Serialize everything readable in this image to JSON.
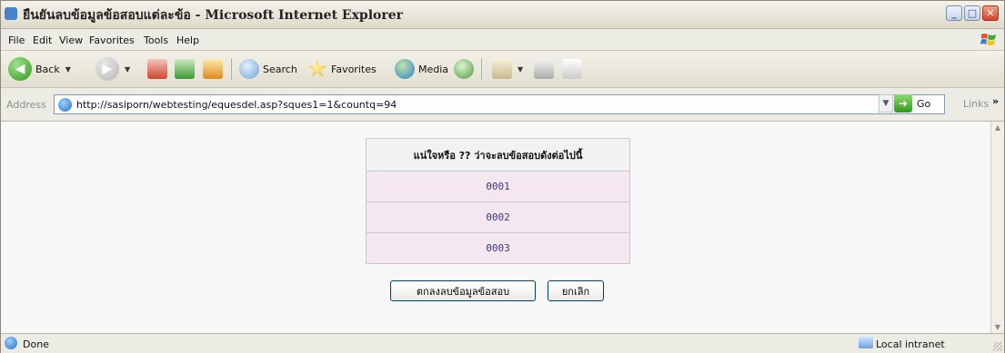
{
  "window": {
    "title": "ยืนยันลบข้อมูลข้อสอบแต่ละข้อ - Microsoft Internet Explorer",
    "icon": "ie-icon"
  },
  "menu": {
    "items": [
      "File",
      "Edit",
      "View",
      "Favorites",
      "Tools",
      "Help"
    ]
  },
  "toolbar": {
    "back_label": "Back",
    "search_label": "Search",
    "favorites_label": "Favorites",
    "media_label": "Media"
  },
  "address": {
    "label": "Address",
    "url": "http://sasiporn/webtesting/equesdel.asp?sques1=1&countq=94",
    "go_label": "Go",
    "links_label": "Links"
  },
  "confirm": {
    "header": "แน่ใจหรือ ?? ว่าจะลบข้อสอบดังต่อไปนี้",
    "items": [
      "0001",
      "0002",
      "0003"
    ]
  },
  "buttons": {
    "confirm_label": "ตกลงลบข้อมูลข้อสอบ",
    "cancel_label": "ยกเลิก"
  },
  "status": {
    "text": "Done",
    "zone": "Local intranet"
  },
  "colors": {
    "row_background": "#f5e7ef",
    "item_text": "#3a3680",
    "header_background": "#f2f2f2",
    "page_background": "#f7f7f7"
  }
}
